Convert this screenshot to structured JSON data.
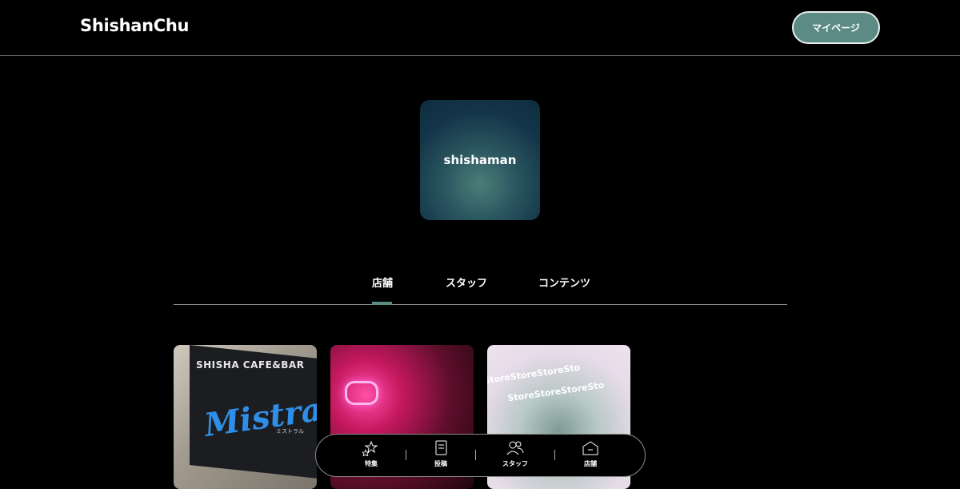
{
  "header": {
    "logo": "ShishanChu",
    "mypage_label": "マイページ"
  },
  "profile": {
    "name": "shishaman"
  },
  "tabs": [
    {
      "label": "店舗",
      "active": true
    },
    {
      "label": "スタッフ",
      "active": false
    },
    {
      "label": "コンテンツ",
      "active": false
    }
  ],
  "cards": [
    {
      "sign_top": "SHISHA CAFE&BAR",
      "sign_script": "Mistral",
      "sign_kana": "ミストラル"
    },
    {
      "image": "neon-bar-interior"
    },
    {
      "text": "StoreStoreStoreSto"
    }
  ],
  "bottom_nav": [
    {
      "label": "特集",
      "icon": "stars-icon"
    },
    {
      "label": "投稿",
      "icon": "document-icon"
    },
    {
      "label": "スタッフ",
      "icon": "people-icon"
    },
    {
      "label": "店舗",
      "icon": "store-icon"
    }
  ],
  "colors": {
    "accent": "#5b8b84",
    "background": "#000000"
  }
}
